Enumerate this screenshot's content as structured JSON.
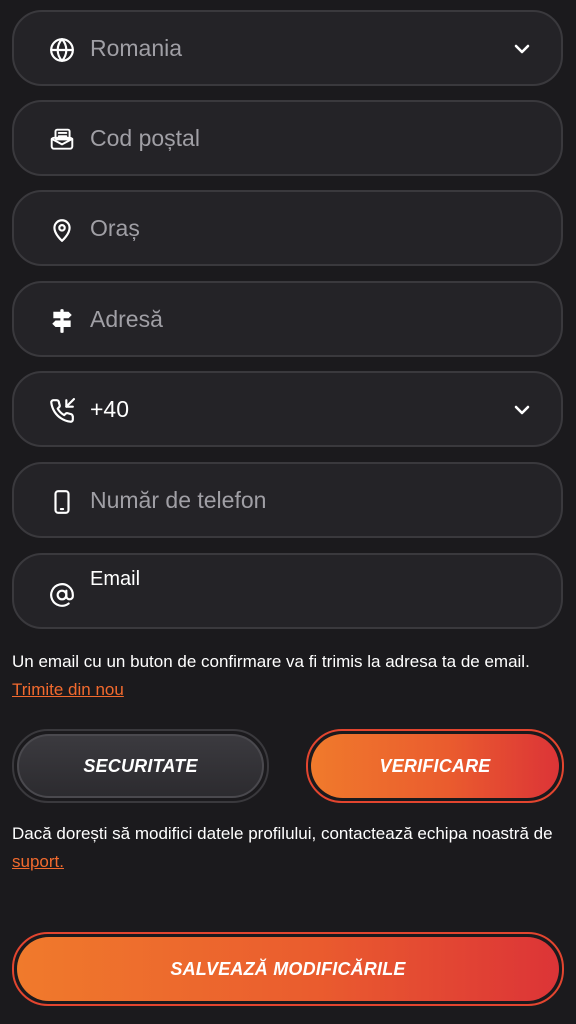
{
  "fields": {
    "country": {
      "value": "Romania",
      "icon": "globe-icon"
    },
    "postal_code": {
      "placeholder": "Cod poștal",
      "icon": "mailbox-icon"
    },
    "city": {
      "placeholder": "Oraș",
      "icon": "map-pin-icon"
    },
    "address": {
      "placeholder": "Adresă",
      "icon": "signpost-icon"
    },
    "phone_prefix": {
      "value": "+40",
      "icon": "phone-incoming-icon"
    },
    "phone_number": {
      "placeholder": "Număr de telefon",
      "icon": "smartphone-icon"
    },
    "email": {
      "label": "Email",
      "icon": "at-sign-icon"
    }
  },
  "email_note": {
    "text": "Un email cu un buton de confirmare va fi trimis la adresa ta de email.",
    "link": "Trimite din nou"
  },
  "buttons": {
    "security": "SECURITATE",
    "verification": "VERIFICARE",
    "save": "SALVEAZĂ MODIFICĂRILE"
  },
  "profile_note": {
    "text": "Dacă dorești să modifici datele profilului, contactează echipa noastră de",
    "link": "suport."
  },
  "colors": {
    "background": "#1b1a1d",
    "field_bg": "#242327",
    "field_border": "#3a393d",
    "placeholder": "#a09fa5",
    "accent_start": "#f07a2c",
    "accent_end": "#dc3437",
    "link": "#f26a2e"
  }
}
